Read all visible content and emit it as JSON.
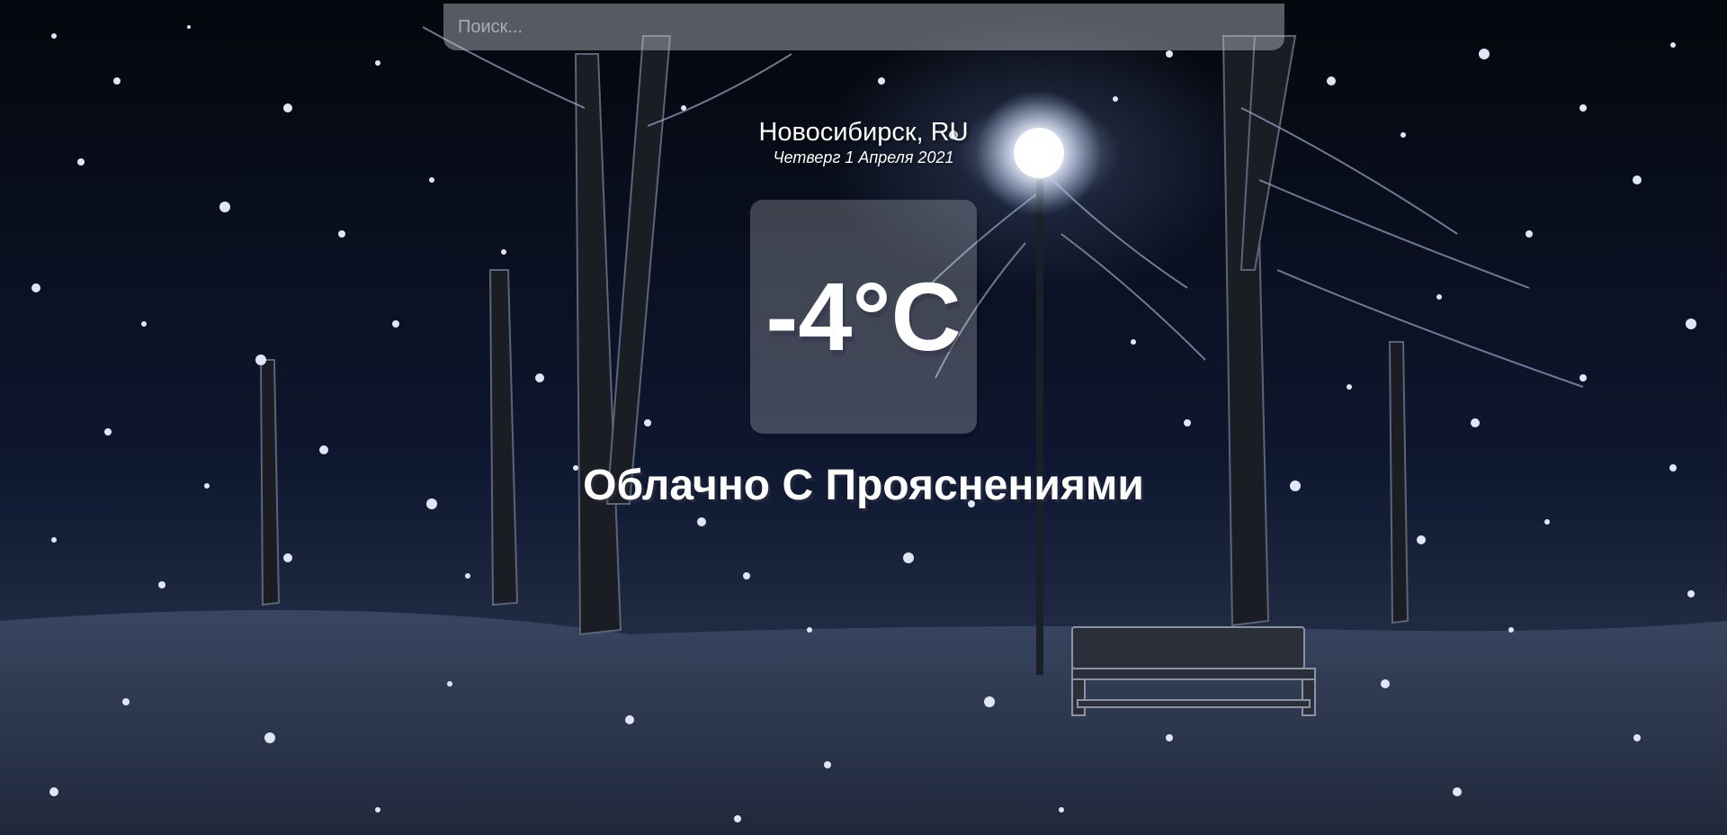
{
  "search": {
    "placeholder": "Поиск..."
  },
  "location": {
    "city": "Новосибирск, RU",
    "date": "Четверг 1 Апреля 2021"
  },
  "weather": {
    "temperature": "-4°C",
    "description": "Облачно С Прояснениями"
  },
  "background": {
    "scene": "snowy-night-park",
    "sky_color": "#05070d",
    "snow_ground_color": "#2b354c",
    "lamp_glow_color": "#ebf0ff"
  }
}
